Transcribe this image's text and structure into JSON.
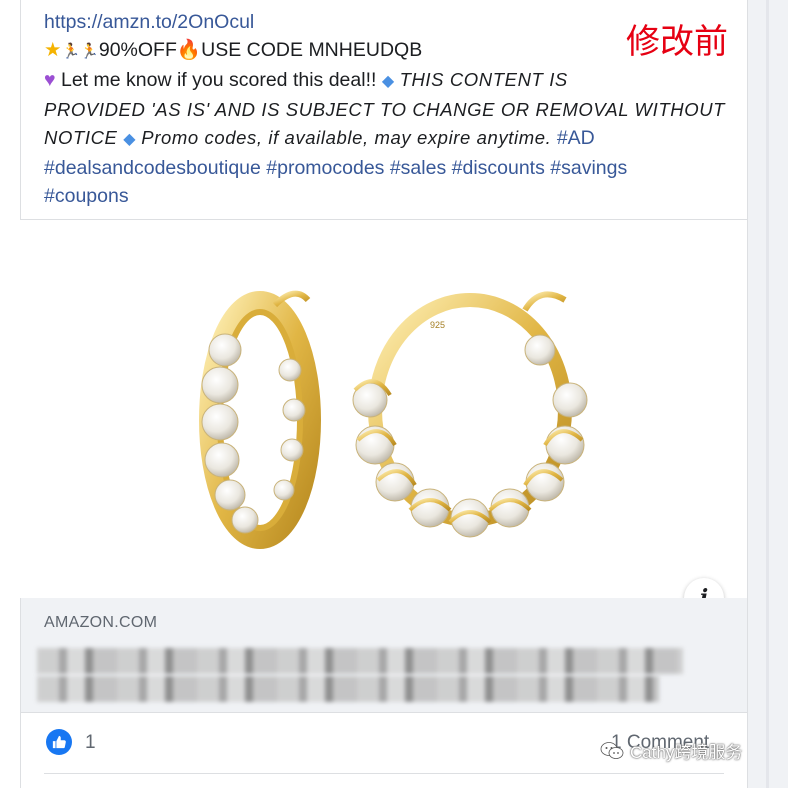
{
  "post": {
    "link_url": "https://amzn.to/2OnOcul",
    "promo_line": "90%OFF",
    "promo_code_text": "USE CODE MNHEUDQB",
    "line3_plain": " Let me know if you scored this deal!! ",
    "line3_italic": "THIS CONTENT IS",
    "line4_italic": "PROVIDED 'AS IS' AND IS SUBJECT TO CHANGE OR REMOVAL WITHOUT",
    "line5_italic": "NOTICE ",
    "line5_italic_b": " Promo codes, if available, may expire anytime.",
    "hashtags_line5": "#AD",
    "hashtags_line6": "#dealsandcodesboutique #promocodes #sales #discounts #savings",
    "hashtags_line7": "#coupons"
  },
  "watermark_top": "修改前",
  "preview": {
    "domain": "AMAZON.COM"
  },
  "reactions": {
    "like_count": "1",
    "comments_label": "1 Comment"
  },
  "watermark_bottom": "Cathy跨境服务",
  "icons": {
    "star": "star-emoji",
    "runner": "runner-emoji",
    "fire": "fire-emoji",
    "heart": "purple-heart-emoji",
    "diamond": "blue-diamond-emoji",
    "info": "info-icon",
    "like": "thumbs-up-icon"
  },
  "colors": {
    "link": "#385898",
    "like_blue": "#1877f2",
    "watermark_red": "#e60012"
  }
}
